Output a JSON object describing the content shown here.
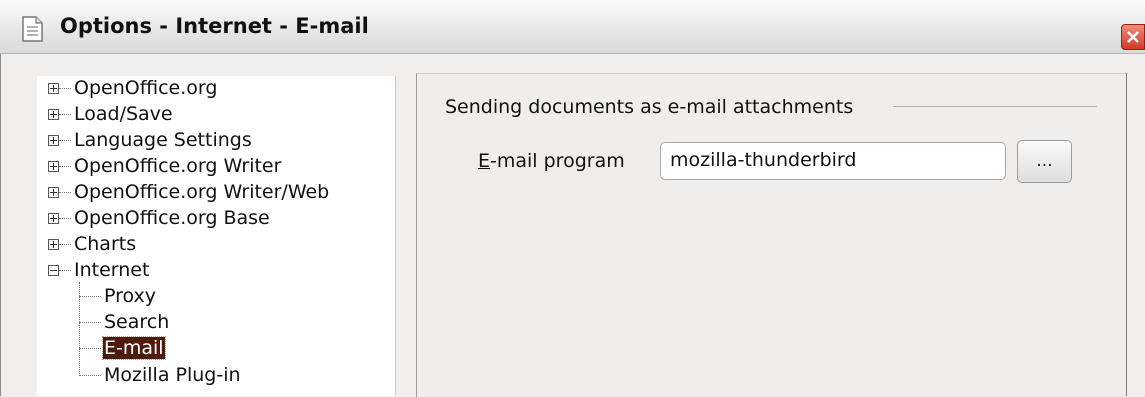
{
  "window": {
    "title": "Options - Internet - E-mail"
  },
  "tree": {
    "items": [
      {
        "label": "OpenOffice.org",
        "expanded": false
      },
      {
        "label": "Load/Save",
        "expanded": false
      },
      {
        "label": "Language Settings",
        "expanded": false
      },
      {
        "label": "OpenOffice.org Writer",
        "expanded": false
      },
      {
        "label": "OpenOffice.org Writer/Web",
        "expanded": false
      },
      {
        "label": "OpenOffice.org Base",
        "expanded": false
      },
      {
        "label": "Charts",
        "expanded": false
      },
      {
        "label": "Internet",
        "expanded": true,
        "children": [
          "Proxy",
          "Search",
          "E-mail",
          "Mozilla Plug-in"
        ]
      }
    ],
    "selected": "E-mail"
  },
  "panel": {
    "section_title": "Sending documents as e-mail attachments",
    "email_program": {
      "mnemonic": "E",
      "label_rest": "-mail program",
      "value": "mozilla-thunderbird",
      "browse_label": "..."
    }
  },
  "colors": {
    "selection": "#4d1a0b",
    "close_button": "#d33a27"
  }
}
